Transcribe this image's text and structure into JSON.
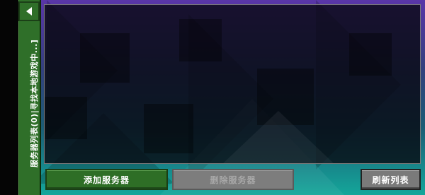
{
  "panel": {
    "title": "服务器列表(0)|寻找本地游戏中...]",
    "back_icon": "back-arrow-icon"
  },
  "toolbar": {
    "add_label": "添加服务器",
    "delete_label": "删除服务器",
    "refresh_label": "刷新列表"
  },
  "colors": {
    "panel_green": "#2f6f29",
    "bg_top": "#5a36a8",
    "bg_bottom": "#14a69a",
    "disabled_gray": "#7d7d7d"
  }
}
